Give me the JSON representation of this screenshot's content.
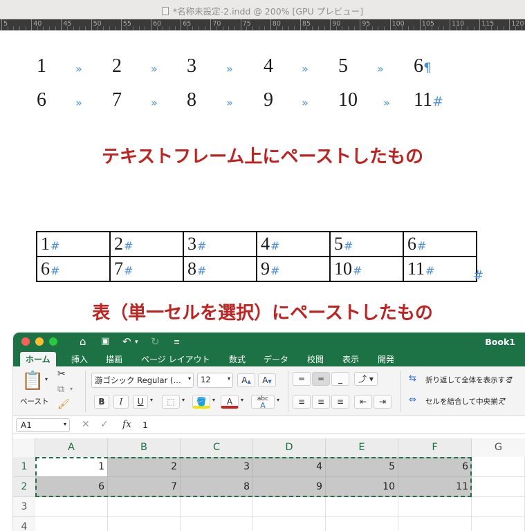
{
  "indesign": {
    "window_title": "*名称未設定-2.indd @ 200% [GPU プレビュー]",
    "ruler_labels": [
      "5",
      "40",
      "45",
      "50",
      "55",
      "60",
      "65",
      "70",
      "75",
      "80",
      "85",
      "90",
      "95",
      "100",
      "105",
      "110",
      "115",
      "120"
    ],
    "frame_row1": [
      "1",
      "2",
      "3",
      "4",
      "5",
      "6"
    ],
    "frame_row2": [
      "6",
      "7",
      "8",
      "9",
      "10",
      "11"
    ],
    "tab_mark": "»",
    "paragraph_mark": "¶",
    "end_mark": "#",
    "caption_frame": "テキストフレーム上にペーストしたもの",
    "table_row1": [
      "1",
      "2",
      "3",
      "4",
      "5",
      "6"
    ],
    "table_row2": [
      "6",
      "7",
      "8",
      "9",
      "10",
      "11"
    ],
    "caption_table": "表（単一セルを選択）にペーストしたもの"
  },
  "excel": {
    "window_title": "Book1",
    "tabs": [
      "ホーム",
      "挿入",
      "描画",
      "ページ レイアウト",
      "数式",
      "データ",
      "校閲",
      "表示",
      "開発"
    ],
    "ribbon": {
      "paste_label": "ペースト",
      "font_name": "游ゴシック Regular (…",
      "font_size": "12",
      "bold": "B",
      "italic": "I",
      "underline": "U",
      "wrap_text": "折り返して全体を表示する",
      "merge_center": "セルを結合して中央揃え"
    },
    "name_box": "A1",
    "formula_value": "1",
    "columns": [
      "A",
      "B",
      "C",
      "D",
      "E",
      "F",
      "G"
    ],
    "rows": [
      "1",
      "2",
      "3",
      "4"
    ],
    "cells_row1": [
      "1",
      "2",
      "3",
      "4",
      "5",
      "6"
    ],
    "cells_row2": [
      "6",
      "7",
      "8",
      "9",
      "10",
      "11"
    ],
    "colors": {
      "accent": "#1d7245",
      "selection": "#c8c8c8",
      "caption": "#c0221f",
      "invisibles": "#4a90d9"
    }
  }
}
